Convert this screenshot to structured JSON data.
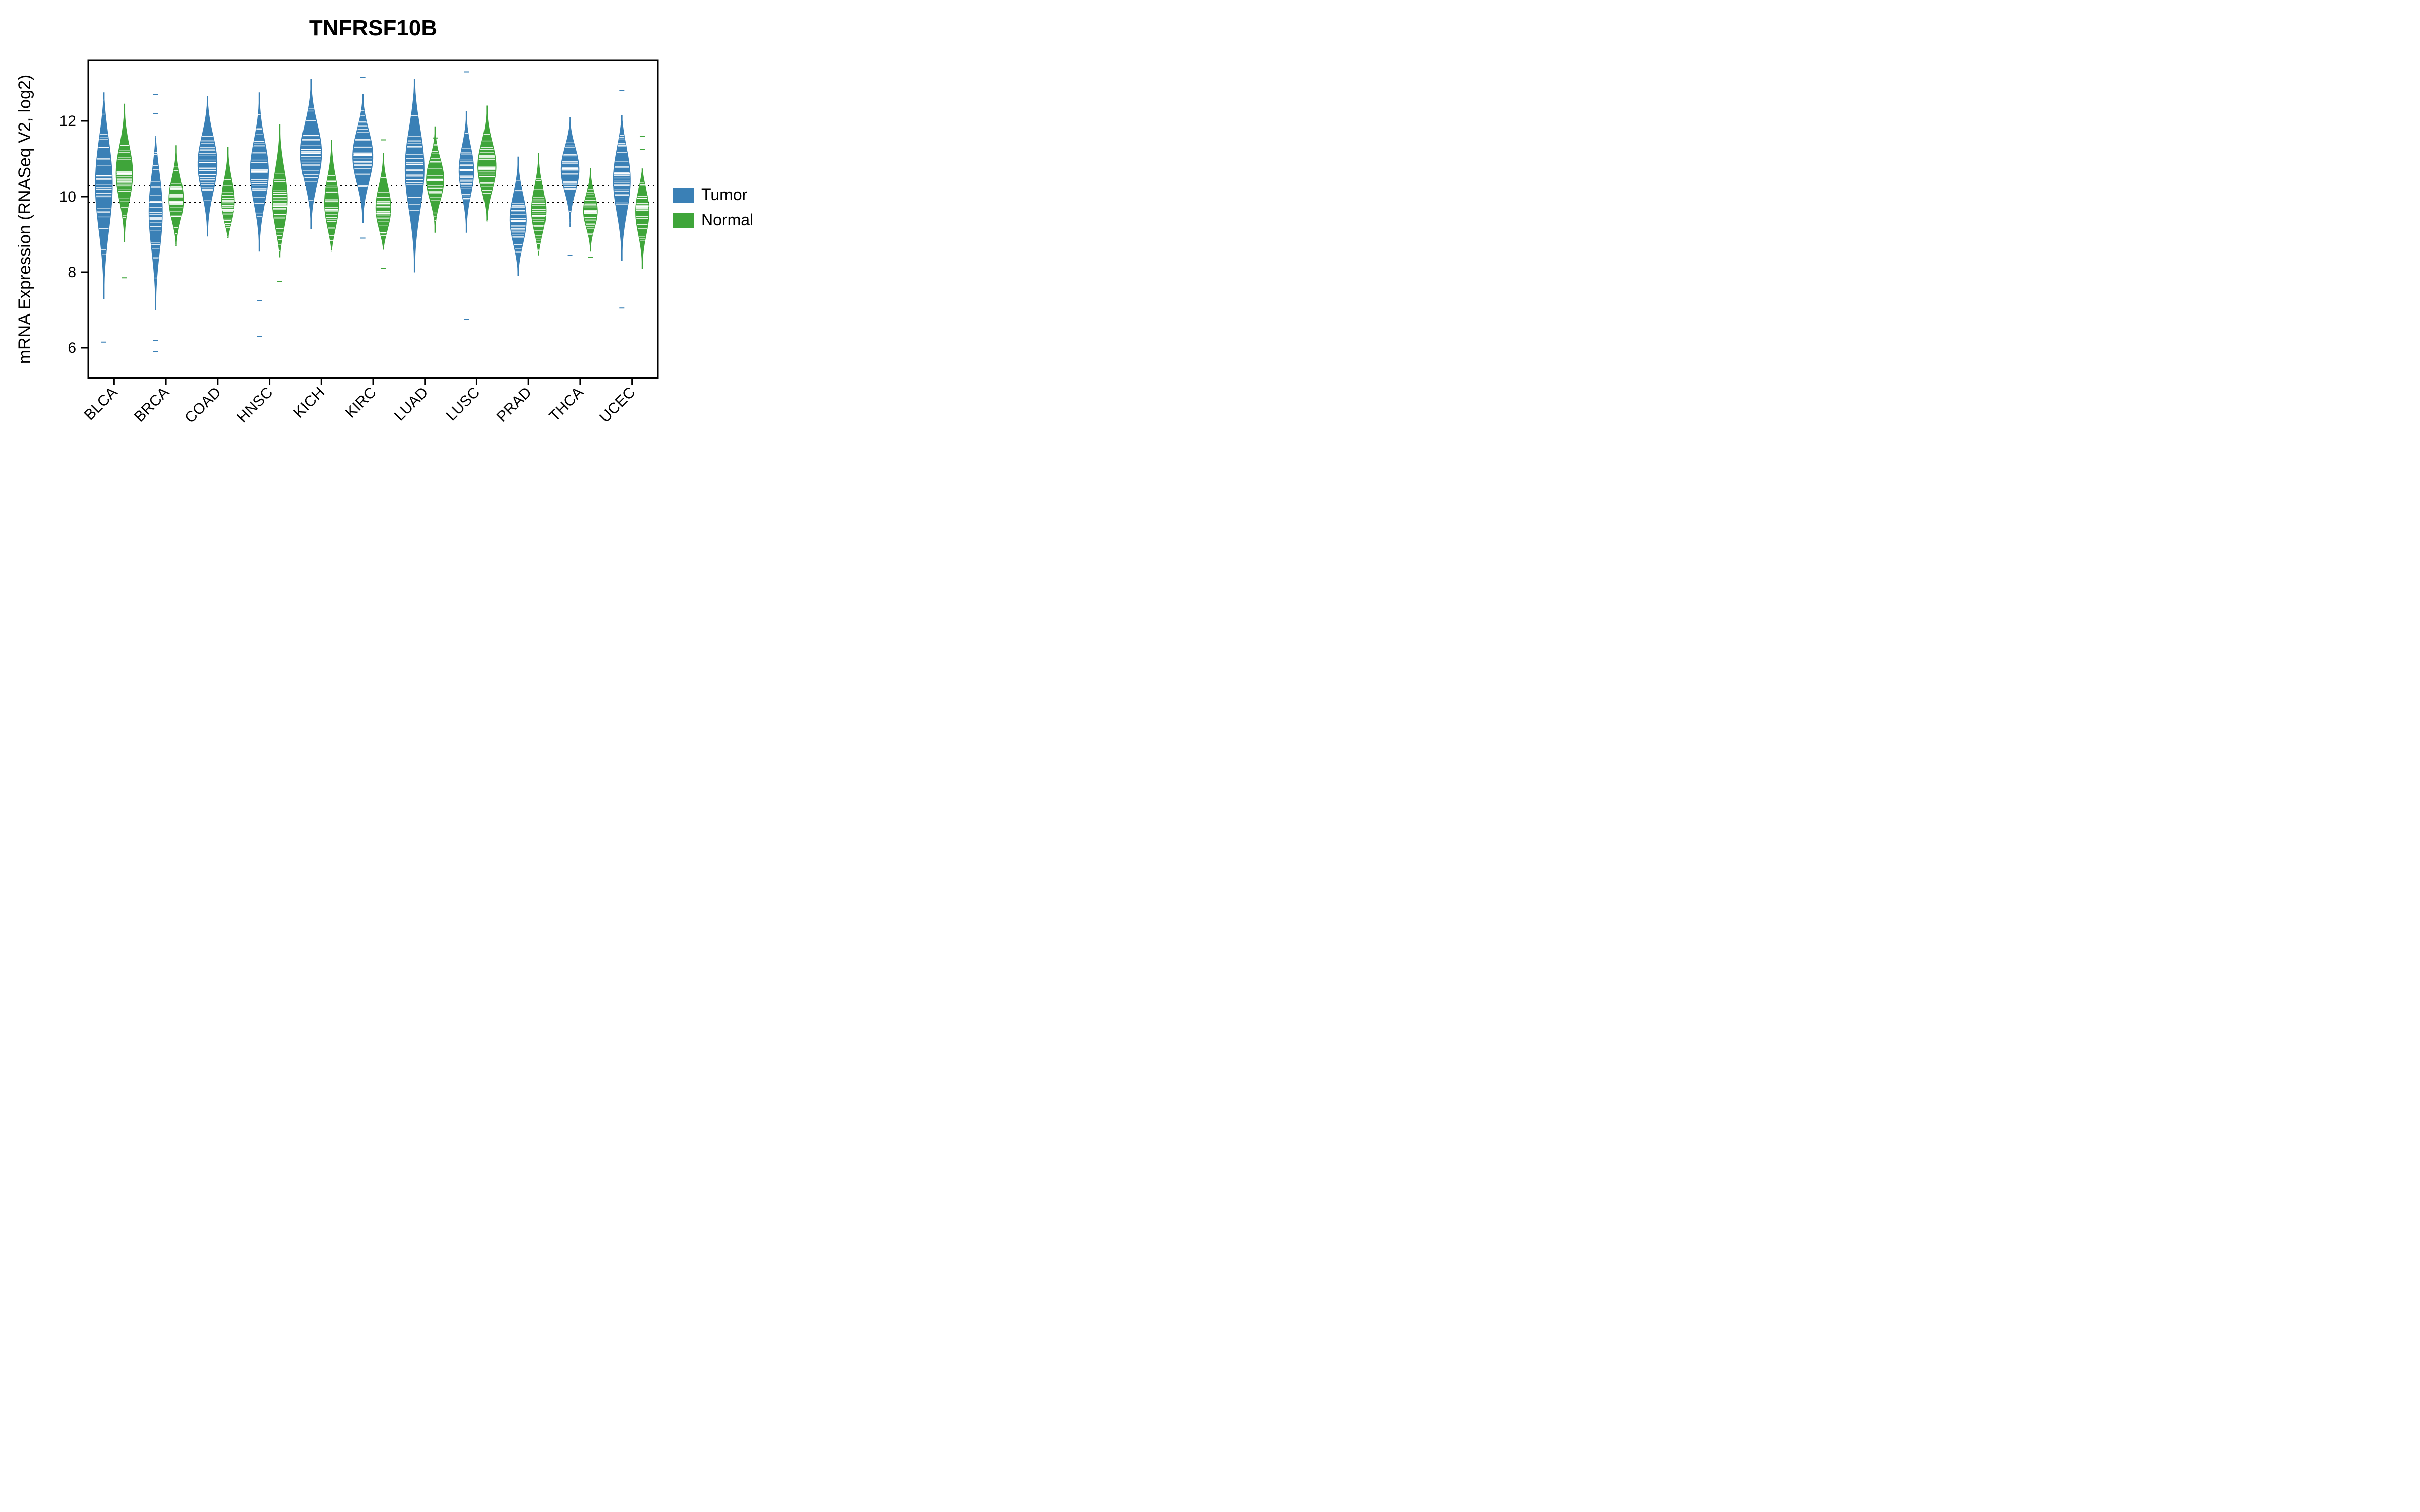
{
  "chart_data": {
    "type": "bar",
    "title": "TNFRSF10B",
    "xlabel": "",
    "ylabel": "mRNA Expression (RNASeq V2, log2)",
    "ylim": [
      5.2,
      13.6
    ],
    "yticks": [
      6,
      8,
      10,
      12
    ],
    "categories": [
      "BLCA",
      "BRCA",
      "COAD",
      "HNSC",
      "KICH",
      "KIRC",
      "LUAD",
      "LUSC",
      "PRAD",
      "THCA",
      "UCEC"
    ],
    "series": [
      {
        "name": "Tumor",
        "color": "#3A80B6",
        "violins": [
          {
            "median": 10.55,
            "low": 7.3,
            "high": 12.75,
            "width": 1.0,
            "outliers": [
              6.15
            ]
          },
          {
            "median": 9.85,
            "low": 7.0,
            "high": 11.6,
            "width": 0.8,
            "outliers": [
              5.9,
              6.2,
              12.2,
              12.7
            ]
          },
          {
            "median": 10.9,
            "low": 8.95,
            "high": 12.65,
            "width": 1.1,
            "outliers": []
          },
          {
            "median": 10.65,
            "low": 8.55,
            "high": 12.75,
            "width": 1.05,
            "outliers": [
              6.3,
              7.25
            ]
          },
          {
            "median": 11.15,
            "low": 9.15,
            "high": 13.1,
            "width": 1.2,
            "outliers": []
          },
          {
            "median": 11.1,
            "low": 9.3,
            "high": 12.7,
            "width": 1.15,
            "outliers": [
              8.9,
              13.15
            ]
          },
          {
            "median": 10.85,
            "low": 8.0,
            "high": 13.1,
            "width": 1.1,
            "outliers": []
          },
          {
            "median": 10.7,
            "low": 9.05,
            "high": 12.25,
            "width": 0.85,
            "outliers": [
              6.75,
              13.3
            ]
          },
          {
            "median": 9.35,
            "low": 7.9,
            "high": 11.05,
            "width": 0.95,
            "outliers": []
          },
          {
            "median": 10.75,
            "low": 9.2,
            "high": 12.1,
            "width": 1.05,
            "outliers": [
              8.45
            ]
          },
          {
            "median": 10.6,
            "low": 8.3,
            "high": 12.15,
            "width": 1.0,
            "outliers": [
              7.05,
              12.8
            ]
          }
        ]
      },
      {
        "name": "Normal",
        "color": "#3FA53A",
        "violins": [
          {
            "median": 10.6,
            "low": 8.8,
            "high": 12.45,
            "width": 0.95,
            "outliers": [
              7.85
            ]
          },
          {
            "median": 9.85,
            "low": 8.7,
            "high": 11.35,
            "width": 0.85,
            "outliers": []
          },
          {
            "median": 9.65,
            "low": 8.9,
            "high": 11.3,
            "width": 0.8,
            "outliers": []
          },
          {
            "median": 9.75,
            "low": 8.4,
            "high": 11.9,
            "width": 0.9,
            "outliers": [
              7.75
            ]
          },
          {
            "median": 9.65,
            "low": 8.55,
            "high": 11.5,
            "width": 0.85,
            "outliers": []
          },
          {
            "median": 9.55,
            "low": 8.6,
            "high": 11.15,
            "width": 0.9,
            "outliers": [
              8.1,
              11.5
            ]
          },
          {
            "median": 10.45,
            "low": 9.05,
            "high": 11.85,
            "width": 1.0,
            "outliers": [
              11.55
            ]
          },
          {
            "median": 10.75,
            "low": 9.35,
            "high": 12.4,
            "width": 1.05,
            "outliers": []
          },
          {
            "median": 9.5,
            "low": 8.45,
            "high": 11.15,
            "width": 0.85,
            "outliers": []
          },
          {
            "median": 9.6,
            "low": 8.55,
            "high": 10.75,
            "width": 0.8,
            "outliers": [
              8.4
            ]
          },
          {
            "median": 9.75,
            "low": 8.1,
            "high": 10.75,
            "width": 0.8,
            "outliers": [
              11.25,
              11.6
            ]
          }
        ]
      }
    ],
    "hlines": [
      10.28,
      9.85
    ],
    "legend": {
      "position": "right",
      "entries": [
        {
          "label": "Tumor",
          "color": "#3A80B6"
        },
        {
          "label": "Normal",
          "color": "#3FA53A"
        }
      ]
    }
  }
}
